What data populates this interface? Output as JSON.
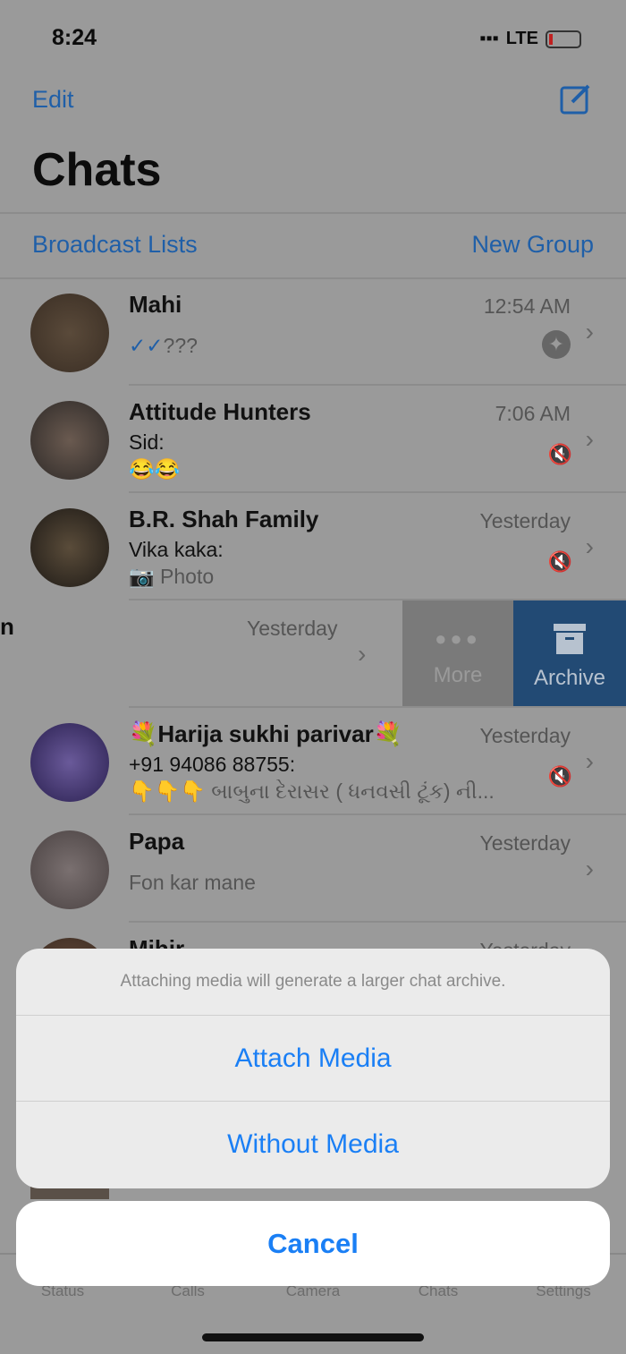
{
  "status": {
    "time": "8:24",
    "network": "LTE"
  },
  "header": {
    "edit": "Edit",
    "title": "Chats",
    "broadcast": "Broadcast Lists",
    "new_group": "New Group"
  },
  "chats": [
    {
      "name": "Mahi",
      "time": "12:54 AM",
      "preview": "???",
      "pinned": true
    },
    {
      "name": "Attitude Hunters",
      "time": "7:06 AM",
      "sender": "Sid:",
      "preview": "😂😂",
      "muted": true
    },
    {
      "name": "B.R. Shah Family",
      "time": "Yesterday",
      "sender": "Vika kaka:",
      "preview": "📷 Photo",
      "muted": true
    },
    {
      "name": "",
      "time": "Yesterday",
      "swiped": true
    },
    {
      "name": "💐Harija sukhi parivar💐",
      "time": "Yesterday",
      "sender": "+91 94086 88755:",
      "preview": "👇👇👇 બાબુના દેરાસર ( ધનવસી ટૂંક) ની...",
      "muted": true
    },
    {
      "name": "Papa",
      "time": "Yesterday",
      "preview": "Fon kar mane"
    },
    {
      "name": "Mihir",
      "time": "Yesterday"
    }
  ],
  "swipe_actions": {
    "more": "More",
    "archive": "Archive"
  },
  "action_sheet": {
    "message": "Attaching media will generate a larger chat archive.",
    "attach": "Attach Media",
    "without": "Without Media",
    "cancel": "Cancel"
  },
  "tabs": [
    "Status",
    "Calls",
    "Camera",
    "Chats",
    "Settings"
  ],
  "active_tab": "Chats",
  "colors": {
    "accent": "#1a7ff5",
    "archive": "#224a74"
  }
}
